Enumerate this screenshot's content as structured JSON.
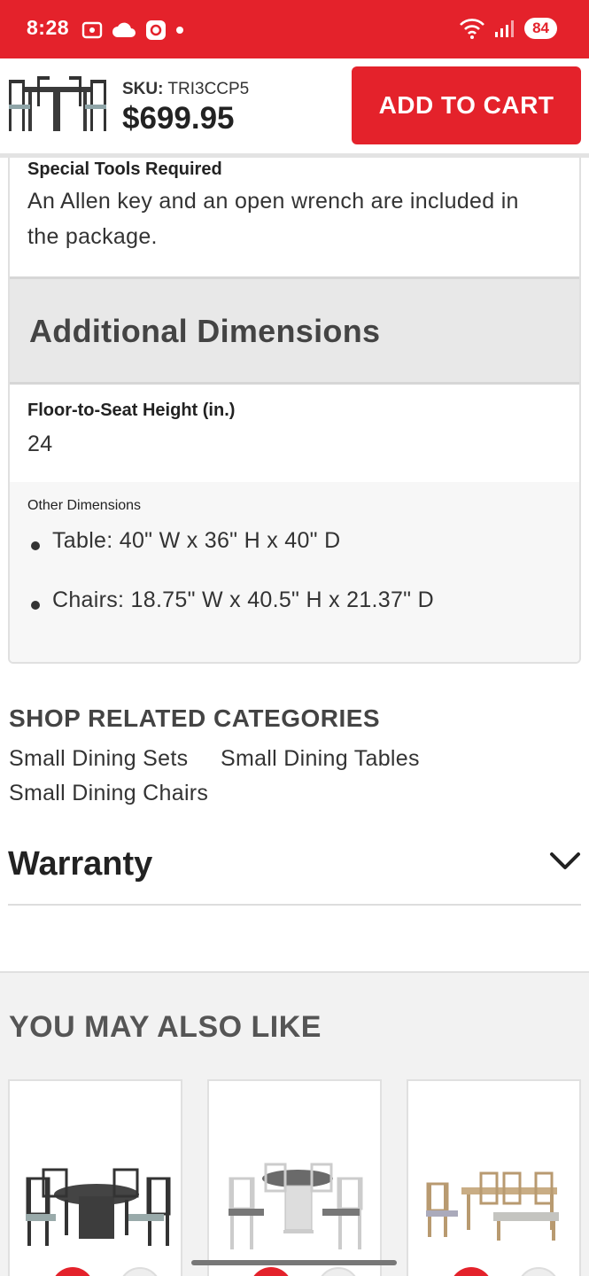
{
  "status_bar": {
    "time": "8:28",
    "battery": "84"
  },
  "header": {
    "sku_label": "SKU:",
    "sku_value": "TRI3CCP5",
    "price": "$699.95",
    "add_to_cart": "ADD TO CART"
  },
  "specs": {
    "tools_label": "Special Tools Required",
    "tools_value_line1": "An Allen key and an open wrench are included in",
    "tools_value_line2": "the package.",
    "additional_title": "Additional Dimensions",
    "seat_label": "Floor-to-Seat Height (in.)",
    "seat_value": "24",
    "other_label": "Other Dimensions",
    "other_items": [
      "Table: 40\" W x 36\" H x 40\" D",
      "Chairs: 18.75\" W x 40.5\" H x 21.37\" D"
    ]
  },
  "related": {
    "title": "SHOP RELATED CATEGORIES",
    "links": [
      "Small Dining Sets",
      "Small Dining Tables",
      "Small Dining Chairs"
    ]
  },
  "warranty": {
    "title": "Warranty"
  },
  "you_may_also_like": {
    "title": "YOU MAY ALSO LIKE"
  },
  "colors": {
    "brand_red": "#e4222b"
  }
}
